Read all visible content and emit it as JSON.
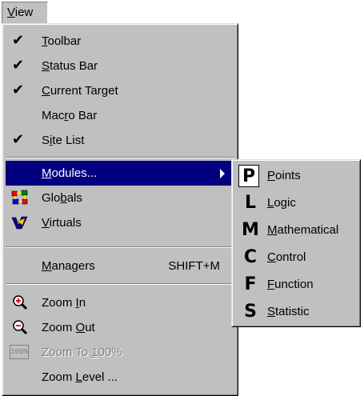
{
  "menubar": {
    "view_label": "View",
    "view_mnemonic": "V",
    "view_rest": "iew"
  },
  "menu": {
    "items": [
      {
        "pre": "",
        "mn": "T",
        "post": "oolbar",
        "checked": true
      },
      {
        "pre": "",
        "mn": "S",
        "post": "tatus Bar",
        "checked": true
      },
      {
        "pre": "",
        "mn": "C",
        "post": "urrent Target",
        "checked": true
      },
      {
        "pre": "Mac",
        "mn": "r",
        "post": "o Bar",
        "checked": false
      },
      {
        "pre": "S",
        "mn": "i",
        "post": "te List",
        "checked": true
      },
      {
        "pre": "",
        "mn": "M",
        "post": "odules...",
        "highlighted": true,
        "submenu": true
      },
      {
        "pre": "Glo",
        "mn": "b",
        "post": "als",
        "icon": "globals-icon"
      },
      {
        "pre": "",
        "mn": "V",
        "post": "irtuals",
        "icon": "virtuals-icon"
      },
      {
        "pre": "",
        "mn": "M",
        "post": "anagers",
        "shortcut": "SHIFT+M"
      },
      {
        "pre": "Zoom ",
        "mn": "I",
        "post": "n",
        "icon": "zoom-in-icon"
      },
      {
        "pre": "Zoom ",
        "mn": "O",
        "post": "ut",
        "icon": "zoom-out-icon"
      },
      {
        "pre": "Zoom To ",
        "mn": "1",
        "post": "00%",
        "icon": "zoom-100-icon",
        "icon_text": "100%",
        "disabled": true
      },
      {
        "pre": "Zoom ",
        "mn": "L",
        "post": "evel ..."
      }
    ]
  },
  "submenu": {
    "items": [
      {
        "letter": "P",
        "mn": "P",
        "post": "oints"
      },
      {
        "letter": "L",
        "mn": "L",
        "post": "ogic"
      },
      {
        "letter": "M",
        "mn": "M",
        "post": "athematical"
      },
      {
        "letter": "C",
        "mn": "C",
        "post": "ontrol"
      },
      {
        "letter": "F",
        "mn": "F",
        "post": "unction"
      },
      {
        "letter": "S",
        "mn": "S",
        "post": "tatistic"
      }
    ]
  },
  "glyphs": {
    "check": "✔"
  }
}
